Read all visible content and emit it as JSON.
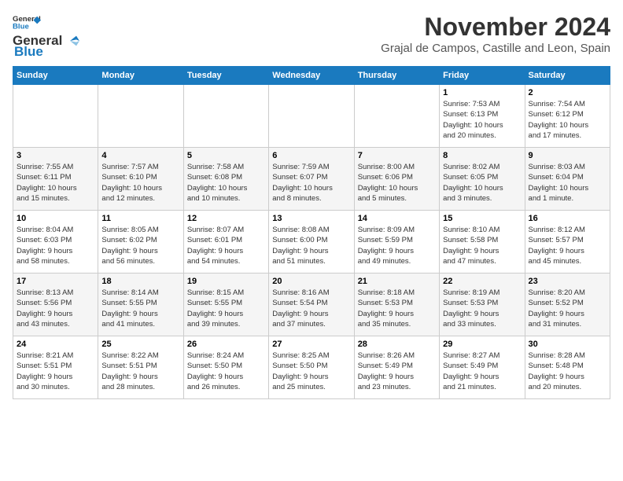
{
  "logo": {
    "line1": "General",
    "line2": "Blue"
  },
  "title": "November 2024",
  "subtitle": "Grajal de Campos, Castille and Leon, Spain",
  "days_of_week": [
    "Sunday",
    "Monday",
    "Tuesday",
    "Wednesday",
    "Thursday",
    "Friday",
    "Saturday"
  ],
  "weeks": [
    [
      {
        "day": "",
        "info": ""
      },
      {
        "day": "",
        "info": ""
      },
      {
        "day": "",
        "info": ""
      },
      {
        "day": "",
        "info": ""
      },
      {
        "day": "",
        "info": ""
      },
      {
        "day": "1",
        "info": "Sunrise: 7:53 AM\nSunset: 6:13 PM\nDaylight: 10 hours\nand 20 minutes."
      },
      {
        "day": "2",
        "info": "Sunrise: 7:54 AM\nSunset: 6:12 PM\nDaylight: 10 hours\nand 17 minutes."
      }
    ],
    [
      {
        "day": "3",
        "info": "Sunrise: 7:55 AM\nSunset: 6:11 PM\nDaylight: 10 hours\nand 15 minutes."
      },
      {
        "day": "4",
        "info": "Sunrise: 7:57 AM\nSunset: 6:10 PM\nDaylight: 10 hours\nand 12 minutes."
      },
      {
        "day": "5",
        "info": "Sunrise: 7:58 AM\nSunset: 6:08 PM\nDaylight: 10 hours\nand 10 minutes."
      },
      {
        "day": "6",
        "info": "Sunrise: 7:59 AM\nSunset: 6:07 PM\nDaylight: 10 hours\nand 8 minutes."
      },
      {
        "day": "7",
        "info": "Sunrise: 8:00 AM\nSunset: 6:06 PM\nDaylight: 10 hours\nand 5 minutes."
      },
      {
        "day": "8",
        "info": "Sunrise: 8:02 AM\nSunset: 6:05 PM\nDaylight: 10 hours\nand 3 minutes."
      },
      {
        "day": "9",
        "info": "Sunrise: 8:03 AM\nSunset: 6:04 PM\nDaylight: 10 hours\nand 1 minute."
      }
    ],
    [
      {
        "day": "10",
        "info": "Sunrise: 8:04 AM\nSunset: 6:03 PM\nDaylight: 9 hours\nand 58 minutes."
      },
      {
        "day": "11",
        "info": "Sunrise: 8:05 AM\nSunset: 6:02 PM\nDaylight: 9 hours\nand 56 minutes."
      },
      {
        "day": "12",
        "info": "Sunrise: 8:07 AM\nSunset: 6:01 PM\nDaylight: 9 hours\nand 54 minutes."
      },
      {
        "day": "13",
        "info": "Sunrise: 8:08 AM\nSunset: 6:00 PM\nDaylight: 9 hours\nand 51 minutes."
      },
      {
        "day": "14",
        "info": "Sunrise: 8:09 AM\nSunset: 5:59 PM\nDaylight: 9 hours\nand 49 minutes."
      },
      {
        "day": "15",
        "info": "Sunrise: 8:10 AM\nSunset: 5:58 PM\nDaylight: 9 hours\nand 47 minutes."
      },
      {
        "day": "16",
        "info": "Sunrise: 8:12 AM\nSunset: 5:57 PM\nDaylight: 9 hours\nand 45 minutes."
      }
    ],
    [
      {
        "day": "17",
        "info": "Sunrise: 8:13 AM\nSunset: 5:56 PM\nDaylight: 9 hours\nand 43 minutes."
      },
      {
        "day": "18",
        "info": "Sunrise: 8:14 AM\nSunset: 5:55 PM\nDaylight: 9 hours\nand 41 minutes."
      },
      {
        "day": "19",
        "info": "Sunrise: 8:15 AM\nSunset: 5:55 PM\nDaylight: 9 hours\nand 39 minutes."
      },
      {
        "day": "20",
        "info": "Sunrise: 8:16 AM\nSunset: 5:54 PM\nDaylight: 9 hours\nand 37 minutes."
      },
      {
        "day": "21",
        "info": "Sunrise: 8:18 AM\nSunset: 5:53 PM\nDaylight: 9 hours\nand 35 minutes."
      },
      {
        "day": "22",
        "info": "Sunrise: 8:19 AM\nSunset: 5:53 PM\nDaylight: 9 hours\nand 33 minutes."
      },
      {
        "day": "23",
        "info": "Sunrise: 8:20 AM\nSunset: 5:52 PM\nDaylight: 9 hours\nand 31 minutes."
      }
    ],
    [
      {
        "day": "24",
        "info": "Sunrise: 8:21 AM\nSunset: 5:51 PM\nDaylight: 9 hours\nand 30 minutes."
      },
      {
        "day": "25",
        "info": "Sunrise: 8:22 AM\nSunset: 5:51 PM\nDaylight: 9 hours\nand 28 minutes."
      },
      {
        "day": "26",
        "info": "Sunrise: 8:24 AM\nSunset: 5:50 PM\nDaylight: 9 hours\nand 26 minutes."
      },
      {
        "day": "27",
        "info": "Sunrise: 8:25 AM\nSunset: 5:50 PM\nDaylight: 9 hours\nand 25 minutes."
      },
      {
        "day": "28",
        "info": "Sunrise: 8:26 AM\nSunset: 5:49 PM\nDaylight: 9 hours\nand 23 minutes."
      },
      {
        "day": "29",
        "info": "Sunrise: 8:27 AM\nSunset: 5:49 PM\nDaylight: 9 hours\nand 21 minutes."
      },
      {
        "day": "30",
        "info": "Sunrise: 8:28 AM\nSunset: 5:48 PM\nDaylight: 9 hours\nand 20 minutes."
      }
    ]
  ]
}
